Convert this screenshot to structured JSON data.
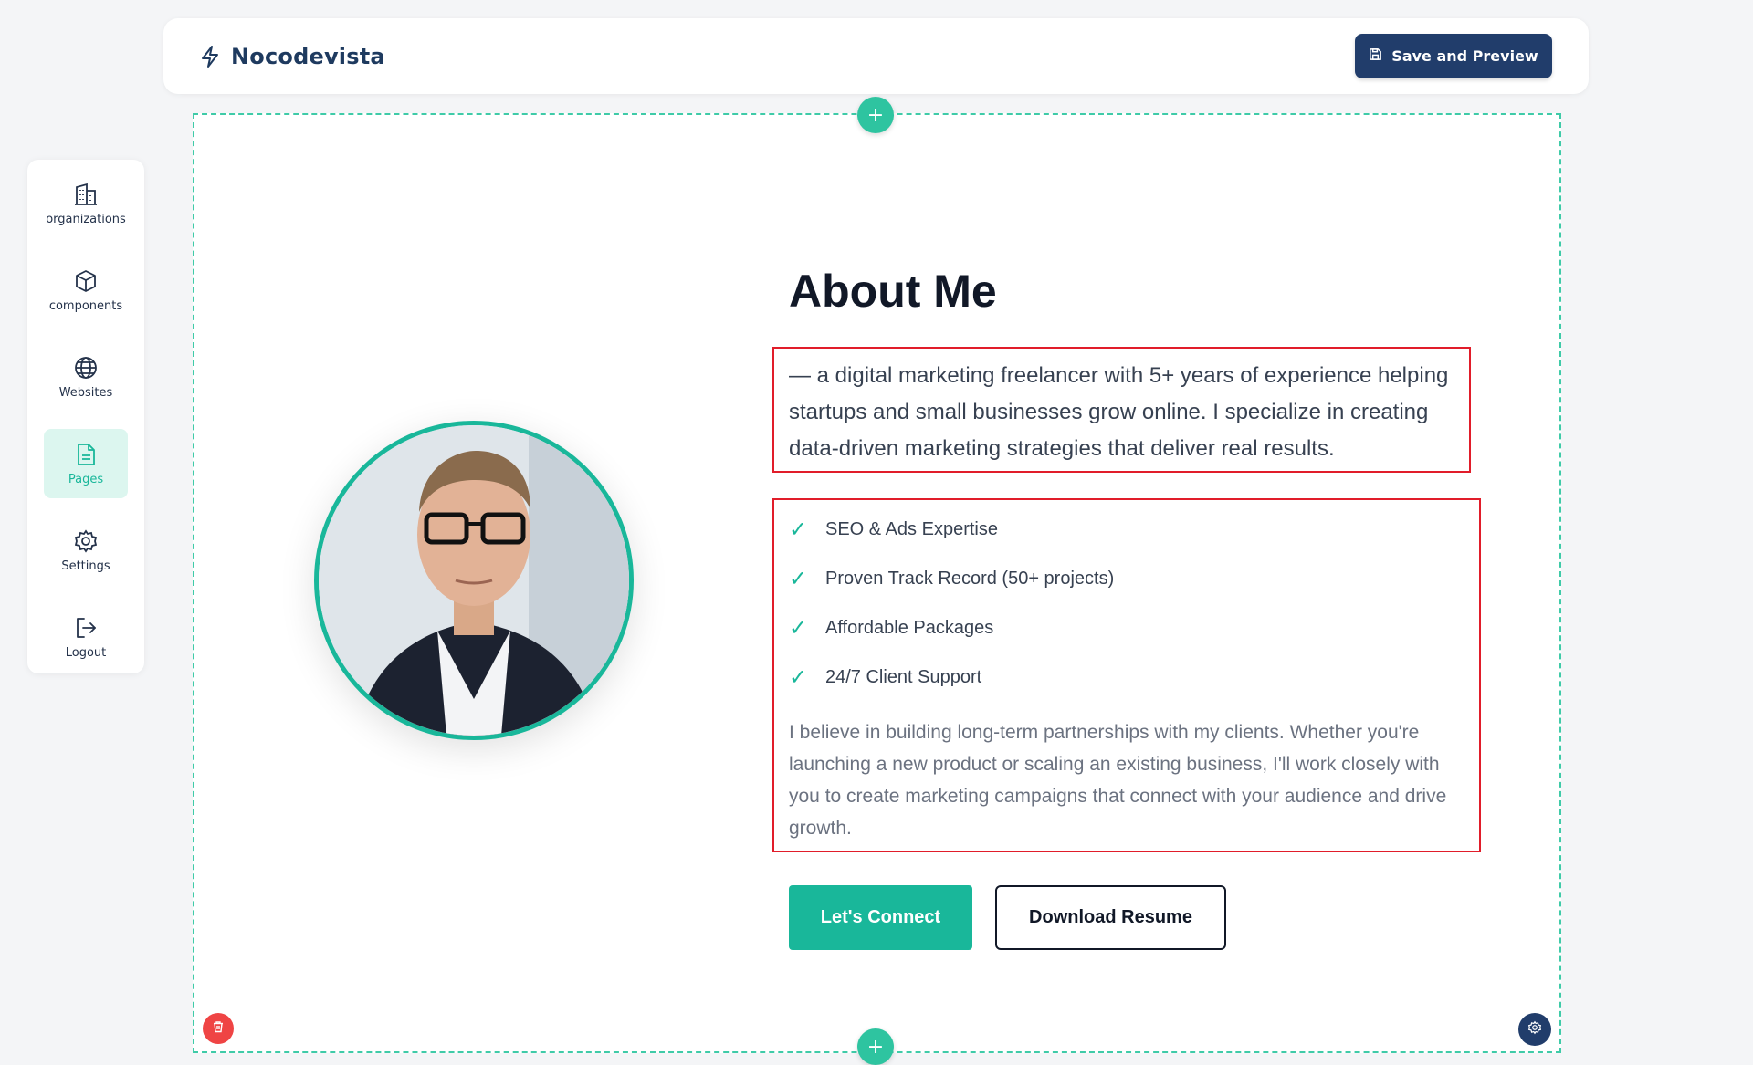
{
  "header": {
    "brand_name": "Nocodevista",
    "brand_icon": "lightning-bolt-icon",
    "save_label": "Save and Preview",
    "save_icon": "floppy-disk-icon"
  },
  "sidebar": {
    "items": [
      {
        "label": "organizations",
        "icon": "building-icon",
        "active": false
      },
      {
        "label": "components",
        "icon": "cube-icon",
        "active": false
      },
      {
        "label": "Websites",
        "icon": "globe-icon",
        "active": false
      },
      {
        "label": "Pages",
        "icon": "file-icon",
        "active": true
      },
      {
        "label": "Settings",
        "icon": "gear-icon",
        "active": false
      },
      {
        "label": "Logout",
        "icon": "logout-icon",
        "active": false
      }
    ]
  },
  "canvas": {
    "add_symbol": "+",
    "delete_icon": "trash-icon",
    "settings_icon": "gear-icon"
  },
  "about": {
    "title": "About Me",
    "intro": "— a digital marketing freelancer with 5+ years of experience helping startups and small businesses grow online. I specialize in creating data-driven marketing strategies that deliver real results.",
    "check_symbol": "✓",
    "features": [
      "SEO & Ads Expertise",
      "Proven Track Record (50+ projects)",
      "Affordable Packages",
      "24/7 Client Support"
    ],
    "belief": "I believe in building long-term partnerships with my clients. Whether you're launching a new product or scaling an existing business, I'll work closely with you to create marketing campaigns that connect with your audience and drive growth.",
    "connect_label": "Let's Connect",
    "resume_label": "Download Resume"
  },
  "colors": {
    "accent": "#19b79a",
    "primary": "#213d6b",
    "highlight_border": "#e11d2a",
    "danger": "#ef4444"
  }
}
